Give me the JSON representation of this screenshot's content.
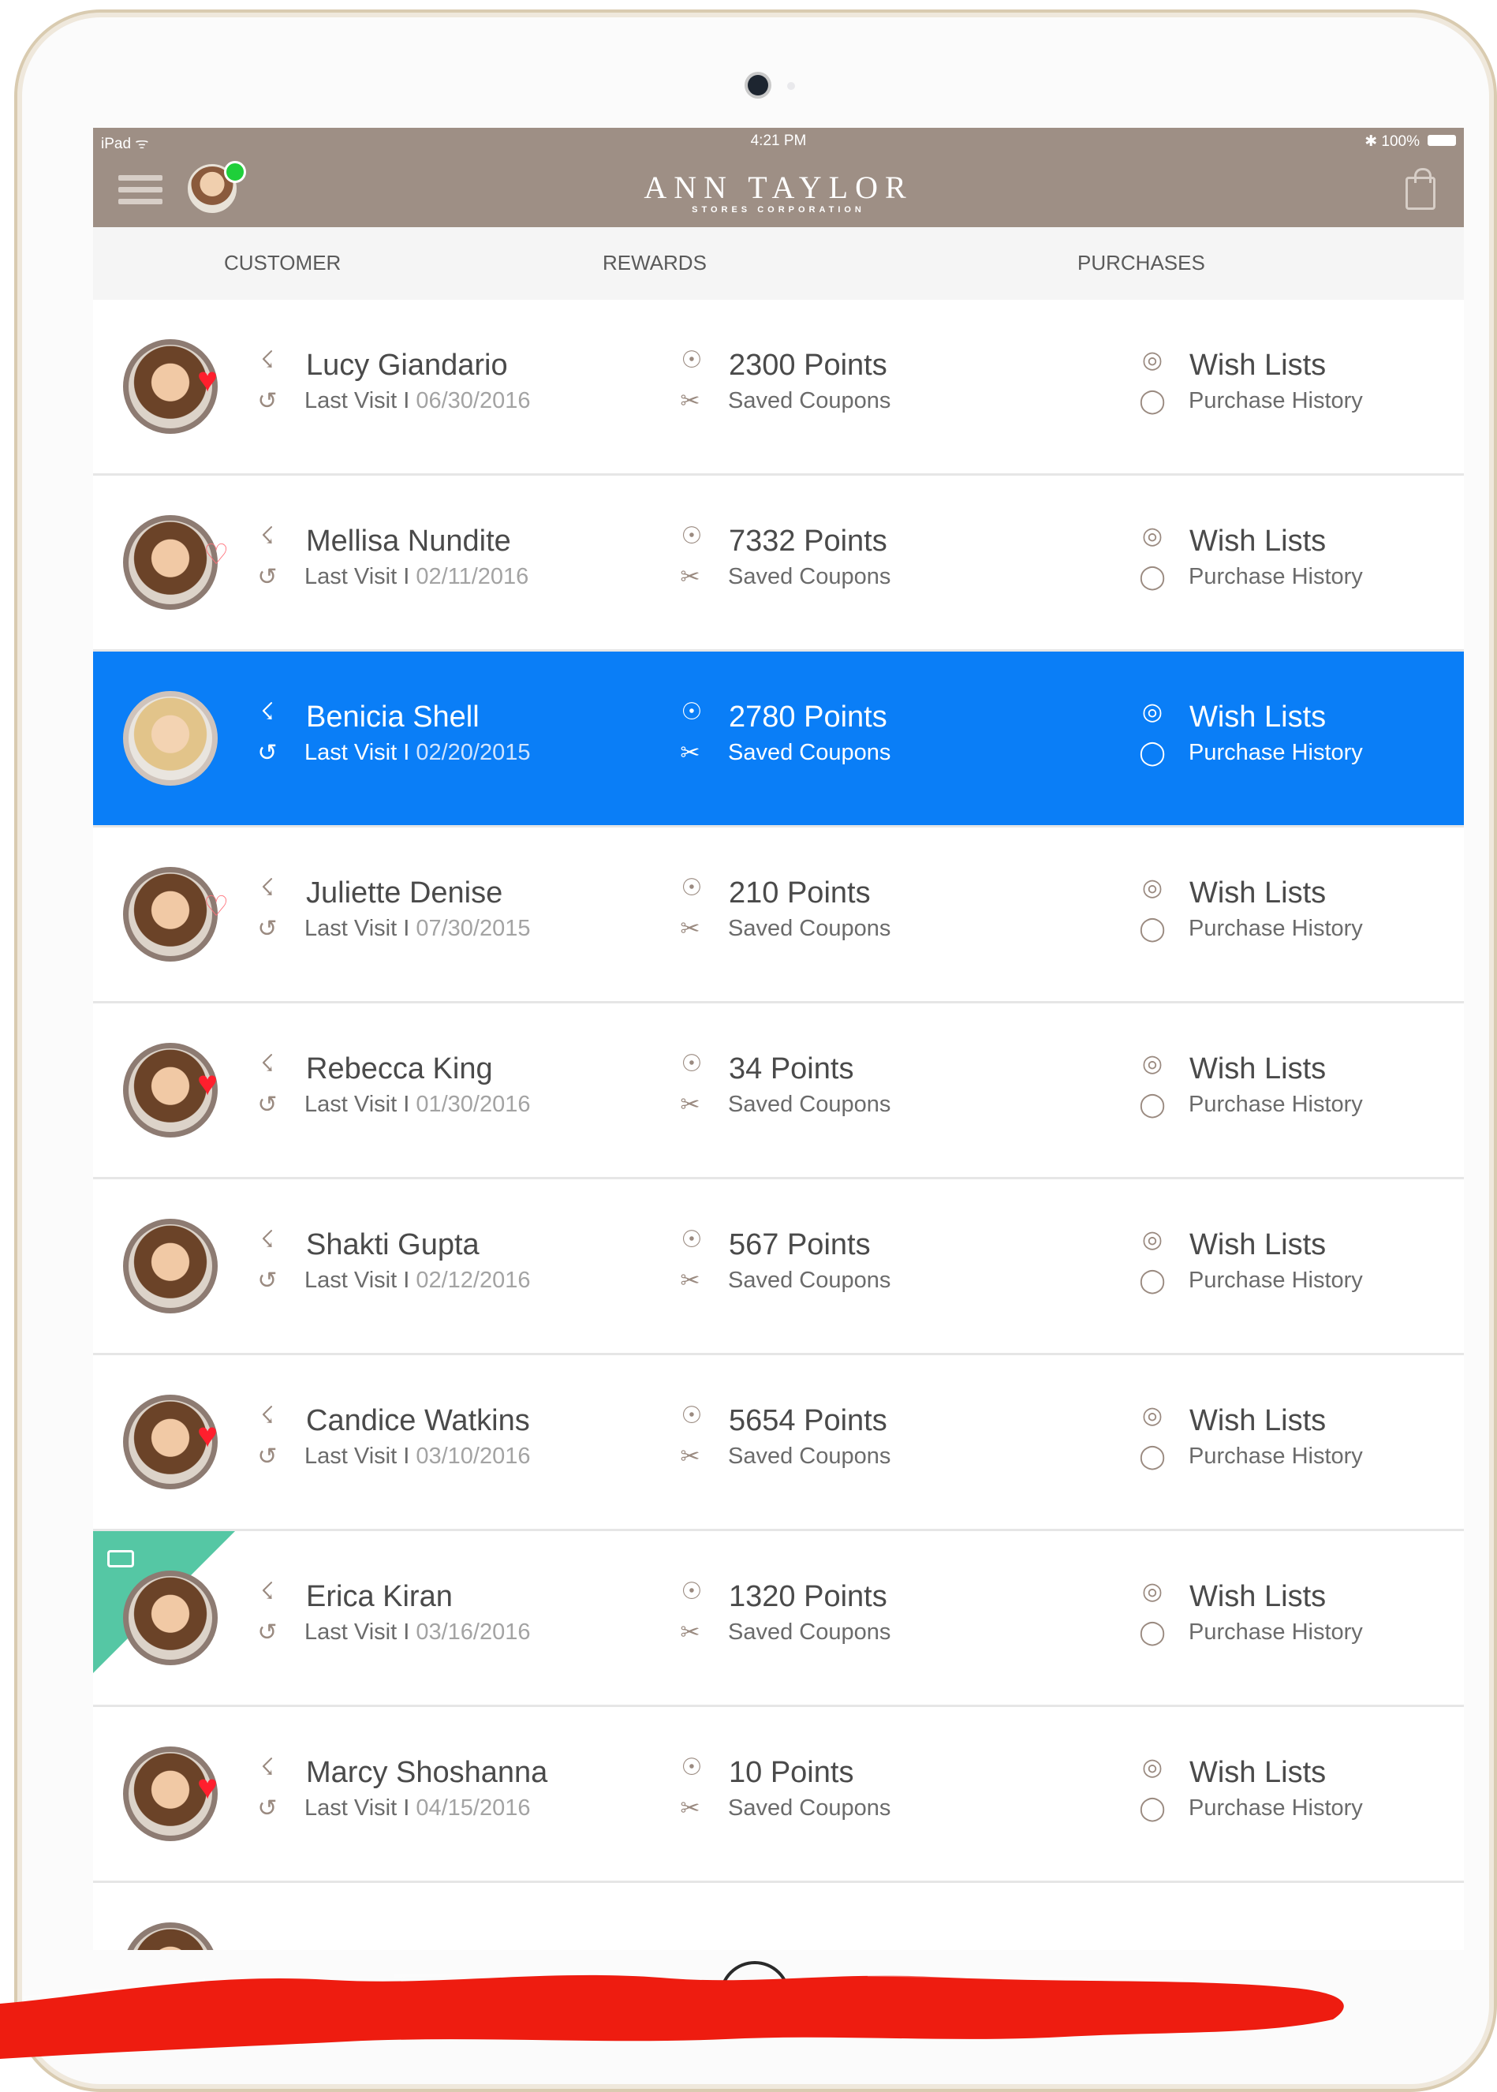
{
  "status_bar": {
    "carrier": "iPad ᯤ",
    "time": "4:21 PM",
    "battery": "✱ 100%"
  },
  "nav": {
    "brand": "ANN TAYLOR",
    "brand_sub": "STORES CORPORATION"
  },
  "columns": {
    "customer": "CUSTOMER",
    "rewards": "REWARDS",
    "purchases": "PURCHASES"
  },
  "row_labels": {
    "last_visit": "Last Visit I ",
    "saved_coupons": "Saved Coupons",
    "wish_lists": "Wish Lists",
    "purchase_history": "Purchase History"
  },
  "customers": [
    {
      "name": "Lucy Giandario",
      "date": "06/30/2016",
      "points": "2300 Points",
      "badge": "heart"
    },
    {
      "name": "Mellisa Nundite",
      "date": "02/11/2016",
      "points": "7332 Points",
      "badge": "heart-outline"
    },
    {
      "name": "Benicia Shell",
      "date": "02/20/2015",
      "points": "2780 Points",
      "badge": "none",
      "selected": true
    },
    {
      "name": "Juliette Denise",
      "date": "07/30/2015",
      "points": "210 Points",
      "badge": "heart-outline"
    },
    {
      "name": "Rebecca King",
      "date": "01/30/2016",
      "points": "34 Points",
      "badge": "heart"
    },
    {
      "name": "Shakti Gupta",
      "date": "02/12/2016",
      "points": "567 Points",
      "badge": "none"
    },
    {
      "name": "Candice Watkins",
      "date": "03/10/2016",
      "points": "5654 Points",
      "badge": "heart"
    },
    {
      "name": "Erica Kiran",
      "date": "03/16/2016",
      "points": "1320 Points",
      "badge": "corner-card"
    },
    {
      "name": "Marcy Shoshanna",
      "date": "04/15/2016",
      "points": "10 Points",
      "badge": "heart"
    }
  ],
  "colors": {
    "nav_bg": "#9e8f85",
    "selected": "#0a7ef7",
    "heart": "#ff1f2d",
    "corner_tag": "#55c7a4",
    "online": "#1fcf3a"
  }
}
